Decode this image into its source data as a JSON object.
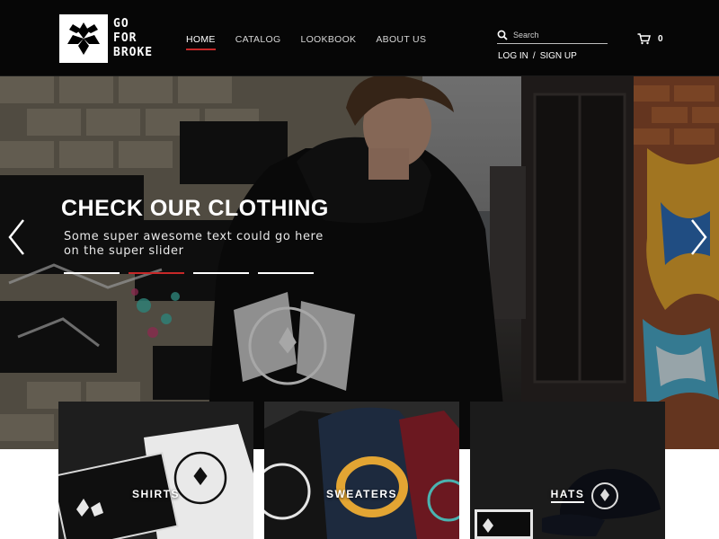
{
  "brand": {
    "lines": [
      "GO",
      "FOR",
      "BROKE"
    ],
    "icon": "go-for-broke-logo-mark"
  },
  "nav": {
    "items": [
      {
        "label": "HOME",
        "active": true
      },
      {
        "label": "CATALOG",
        "active": false
      },
      {
        "label": "LOOKBOOK",
        "active": false
      },
      {
        "label": "ABOUT US",
        "active": false
      }
    ]
  },
  "search": {
    "placeholder": "Search",
    "value": "",
    "icon": "search-icon"
  },
  "cart": {
    "count": "0",
    "icon": "cart-icon"
  },
  "auth": {
    "login": "LOG IN",
    "separator": "/",
    "signup": "SIGN UP"
  },
  "hero": {
    "title": "CHECK OUR CLOTHING",
    "subtitle": "Some super awesome text could go here on the super slider",
    "slide_count": 4,
    "active_slide": 2,
    "prev_icon": "chevron-left-icon",
    "next_icon": "chevron-right-icon"
  },
  "categories": [
    {
      "label": "SHIRTS"
    },
    {
      "label": "SWEATERS"
    },
    {
      "label": "HATS"
    }
  ],
  "colors": {
    "header_bg": "#060606",
    "accent": "#c62828",
    "text": "#ffffff"
  }
}
